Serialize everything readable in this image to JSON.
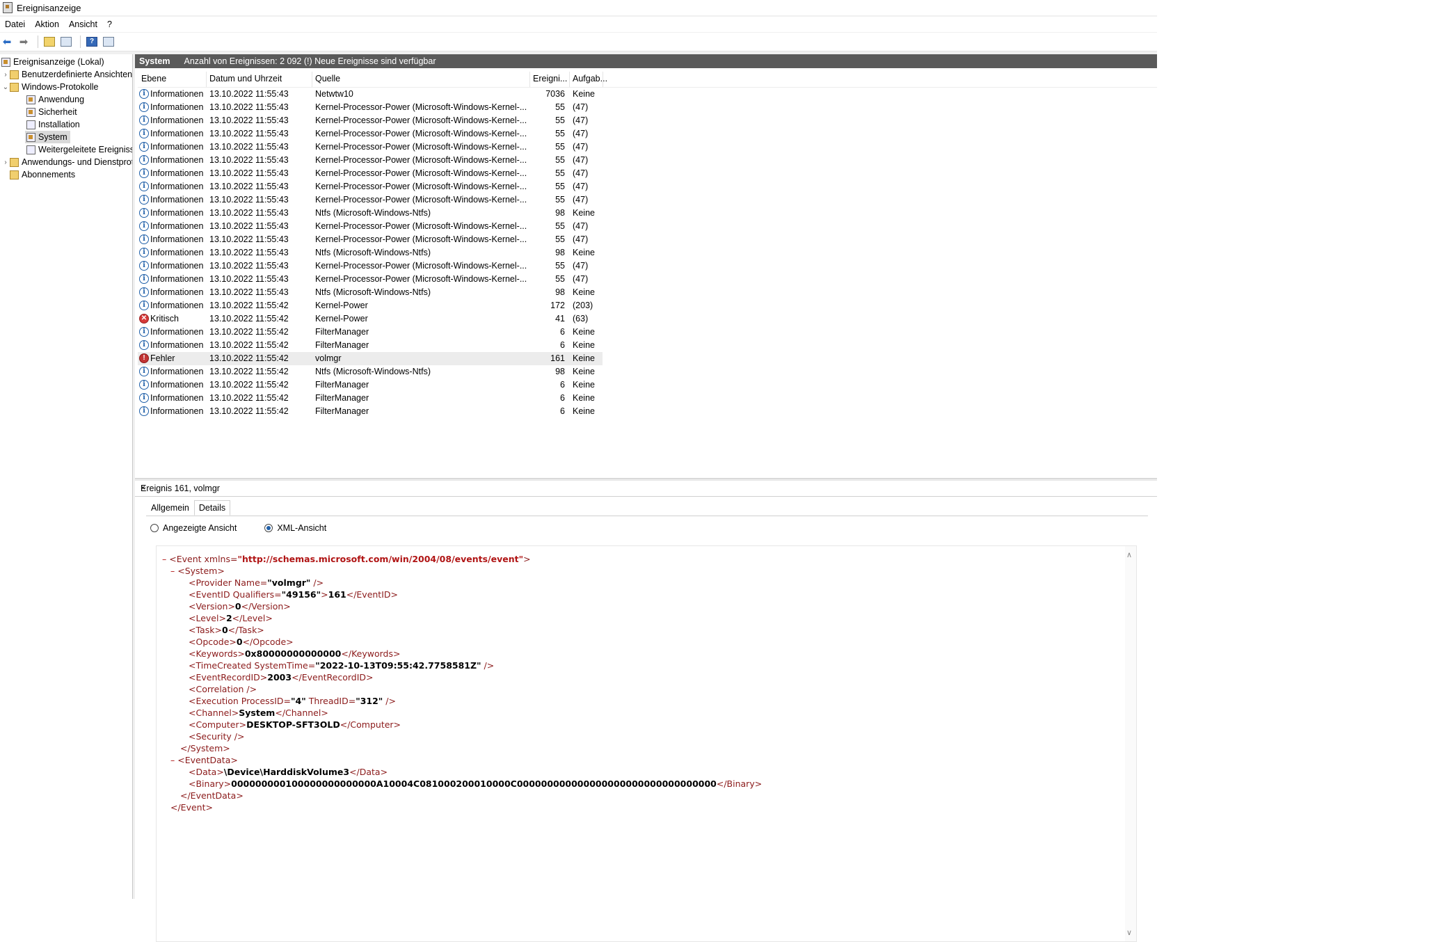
{
  "window": {
    "title": "Ereignisanzeige"
  },
  "menu": [
    "Datei",
    "Aktion",
    "Ansicht",
    "?"
  ],
  "tree": {
    "root": "Ereignisanzeige (Lokal)",
    "custom": "Benutzerdefinierte Ansichten",
    "winlogs": "Windows-Protokolle",
    "app": "Anwendung",
    "security": "Sicherheit",
    "install": "Installation",
    "system": "System",
    "forwarded": "Weitergeleitete Ereignisse",
    "appservices": "Anwendungs- und Dienstprotokolle",
    "subs": "Abonnements"
  },
  "header": {
    "log": "System",
    "info": "Anzahl von Ereignissen: 2 092 (!) Neue Ereignisse sind verfügbar"
  },
  "columns": {
    "level": "Ebene",
    "date": "Datum und Uhrzeit",
    "source": "Quelle",
    "id": "Ereigni...",
    "task": "Aufgab..."
  },
  "events": [
    {
      "level": "Informationen",
      "type": "info",
      "date": "13.10.2022 11:55:43",
      "source": "Netwtw10",
      "id": "7036",
      "task": "Keine"
    },
    {
      "level": "Informationen",
      "type": "info",
      "date": "13.10.2022 11:55:43",
      "source": "Kernel-Processor-Power (Microsoft-Windows-Kernel-...",
      "id": "55",
      "task": "(47)"
    },
    {
      "level": "Informationen",
      "type": "info",
      "date": "13.10.2022 11:55:43",
      "source": "Kernel-Processor-Power (Microsoft-Windows-Kernel-...",
      "id": "55",
      "task": "(47)"
    },
    {
      "level": "Informationen",
      "type": "info",
      "date": "13.10.2022 11:55:43",
      "source": "Kernel-Processor-Power (Microsoft-Windows-Kernel-...",
      "id": "55",
      "task": "(47)"
    },
    {
      "level": "Informationen",
      "type": "info",
      "date": "13.10.2022 11:55:43",
      "source": "Kernel-Processor-Power (Microsoft-Windows-Kernel-...",
      "id": "55",
      "task": "(47)"
    },
    {
      "level": "Informationen",
      "type": "info",
      "date": "13.10.2022 11:55:43",
      "source": "Kernel-Processor-Power (Microsoft-Windows-Kernel-...",
      "id": "55",
      "task": "(47)"
    },
    {
      "level": "Informationen",
      "type": "info",
      "date": "13.10.2022 11:55:43",
      "source": "Kernel-Processor-Power (Microsoft-Windows-Kernel-...",
      "id": "55",
      "task": "(47)"
    },
    {
      "level": "Informationen",
      "type": "info",
      "date": "13.10.2022 11:55:43",
      "source": "Kernel-Processor-Power (Microsoft-Windows-Kernel-...",
      "id": "55",
      "task": "(47)"
    },
    {
      "level": "Informationen",
      "type": "info",
      "date": "13.10.2022 11:55:43",
      "source": "Kernel-Processor-Power (Microsoft-Windows-Kernel-...",
      "id": "55",
      "task": "(47)"
    },
    {
      "level": "Informationen",
      "type": "info",
      "date": "13.10.2022 11:55:43",
      "source": "Ntfs (Microsoft-Windows-Ntfs)",
      "id": "98",
      "task": "Keine"
    },
    {
      "level": "Informationen",
      "type": "info",
      "date": "13.10.2022 11:55:43",
      "source": "Kernel-Processor-Power (Microsoft-Windows-Kernel-...",
      "id": "55",
      "task": "(47)"
    },
    {
      "level": "Informationen",
      "type": "info",
      "date": "13.10.2022 11:55:43",
      "source": "Kernel-Processor-Power (Microsoft-Windows-Kernel-...",
      "id": "55",
      "task": "(47)"
    },
    {
      "level": "Informationen",
      "type": "info",
      "date": "13.10.2022 11:55:43",
      "source": "Ntfs (Microsoft-Windows-Ntfs)",
      "id": "98",
      "task": "Keine"
    },
    {
      "level": "Informationen",
      "type": "info",
      "date": "13.10.2022 11:55:43",
      "source": "Kernel-Processor-Power (Microsoft-Windows-Kernel-...",
      "id": "55",
      "task": "(47)"
    },
    {
      "level": "Informationen",
      "type": "info",
      "date": "13.10.2022 11:55:43",
      "source": "Kernel-Processor-Power (Microsoft-Windows-Kernel-...",
      "id": "55",
      "task": "(47)"
    },
    {
      "level": "Informationen",
      "type": "info",
      "date": "13.10.2022 11:55:43",
      "source": "Ntfs (Microsoft-Windows-Ntfs)",
      "id": "98",
      "task": "Keine"
    },
    {
      "level": "Informationen",
      "type": "info",
      "date": "13.10.2022 11:55:42",
      "source": "Kernel-Power",
      "id": "172",
      "task": "(203)"
    },
    {
      "level": "Kritisch",
      "type": "crit",
      "date": "13.10.2022 11:55:42",
      "source": "Kernel-Power",
      "id": "41",
      "task": "(63)"
    },
    {
      "level": "Informationen",
      "type": "info",
      "date": "13.10.2022 11:55:42",
      "source": "FilterManager",
      "id": "6",
      "task": "Keine"
    },
    {
      "level": "Informationen",
      "type": "info",
      "date": "13.10.2022 11:55:42",
      "source": "FilterManager",
      "id": "6",
      "task": "Keine"
    },
    {
      "level": "Fehler",
      "type": "err",
      "date": "13.10.2022 11:55:42",
      "source": "volmgr",
      "id": "161",
      "task": "Keine",
      "selected": true
    },
    {
      "level": "Informationen",
      "type": "info",
      "date": "13.10.2022 11:55:42",
      "source": "Ntfs (Microsoft-Windows-Ntfs)",
      "id": "98",
      "task": "Keine"
    },
    {
      "level": "Informationen",
      "type": "info",
      "date": "13.10.2022 11:55:42",
      "source": "FilterManager",
      "id": "6",
      "task": "Keine"
    },
    {
      "level": "Informationen",
      "type": "info",
      "date": "13.10.2022 11:55:42",
      "source": "FilterManager",
      "id": "6",
      "task": "Keine"
    },
    {
      "level": "Informationen",
      "type": "info",
      "date": "13.10.2022 11:55:42",
      "source": "FilterManager",
      "id": "6",
      "task": "Keine"
    }
  ],
  "detail": {
    "title": "Ereignis 161, volmgr",
    "close": "×",
    "tab_general": "Allgemein",
    "tab_details": "Details",
    "radio_friendly": "Angezeigte Ansicht",
    "radio_xml": "XML-Ansicht"
  },
  "xml": {
    "minus": "–",
    "event_open": "<Event xmlns=",
    "ns": "\"http://schemas.microsoft.com/win/2004/08/events/event\"",
    "gt": ">",
    "system_open": "<System>",
    "provider_a": "<Provider Name=",
    "provider_v": "\"volmgr\"",
    "provider_b": " />",
    "eventid_a": "<EventID Qualifiers=",
    "eventid_q": "\"49156\"",
    "eventid_b": ">",
    "eventid_v": "161",
    "eventid_c": "</EventID>",
    "version_a": "<Version>",
    "version_v": "0",
    "version_b": "</Version>",
    "level_a": "<Level>",
    "level_v": "2",
    "level_b": "</Level>",
    "task_a": "<Task>",
    "task_v": "0",
    "task_b": "</Task>",
    "opcode_a": "<Opcode>",
    "opcode_v": "0",
    "opcode_b": "</Opcode>",
    "keywords_a": "<Keywords>",
    "keywords_v": "0x80000000000000",
    "keywords_b": "</Keywords>",
    "time_a": "<TimeCreated SystemTime=",
    "time_v": "\"2022-10-13T09:55:42.7758581Z\"",
    "time_b": " />",
    "rec_a": "<EventRecordID>",
    "rec_v": "2003",
    "rec_b": "</EventRecordID>",
    "corr": "<Correlation />",
    "exec_a": "<Execution ProcessID=",
    "exec_p": "\"4\"",
    "exec_b": " ThreadID=",
    "exec_t": "\"312\"",
    "exec_c": " />",
    "chan_a": "<Channel>",
    "chan_v": "System",
    "chan_b": "</Channel>",
    "comp_a": "<Computer>",
    "comp_v": "DESKTOP-SFT3OLD",
    "comp_b": "</Computer>",
    "sec": "<Security />",
    "system_close": "</System>",
    "edata_open": "<EventData>",
    "data_a": "<Data>",
    "data_v": "\\Device\\HarddiskVolume3",
    "data_b": "</Data>",
    "bin_a": "<Binary>",
    "bin_v": "000000000100000000000000A10004C081000200010000C000000000000000000000000000000000",
    "bin_b": "</Binary>",
    "edata_close": "</EventData>",
    "event_close": "</Event>"
  }
}
